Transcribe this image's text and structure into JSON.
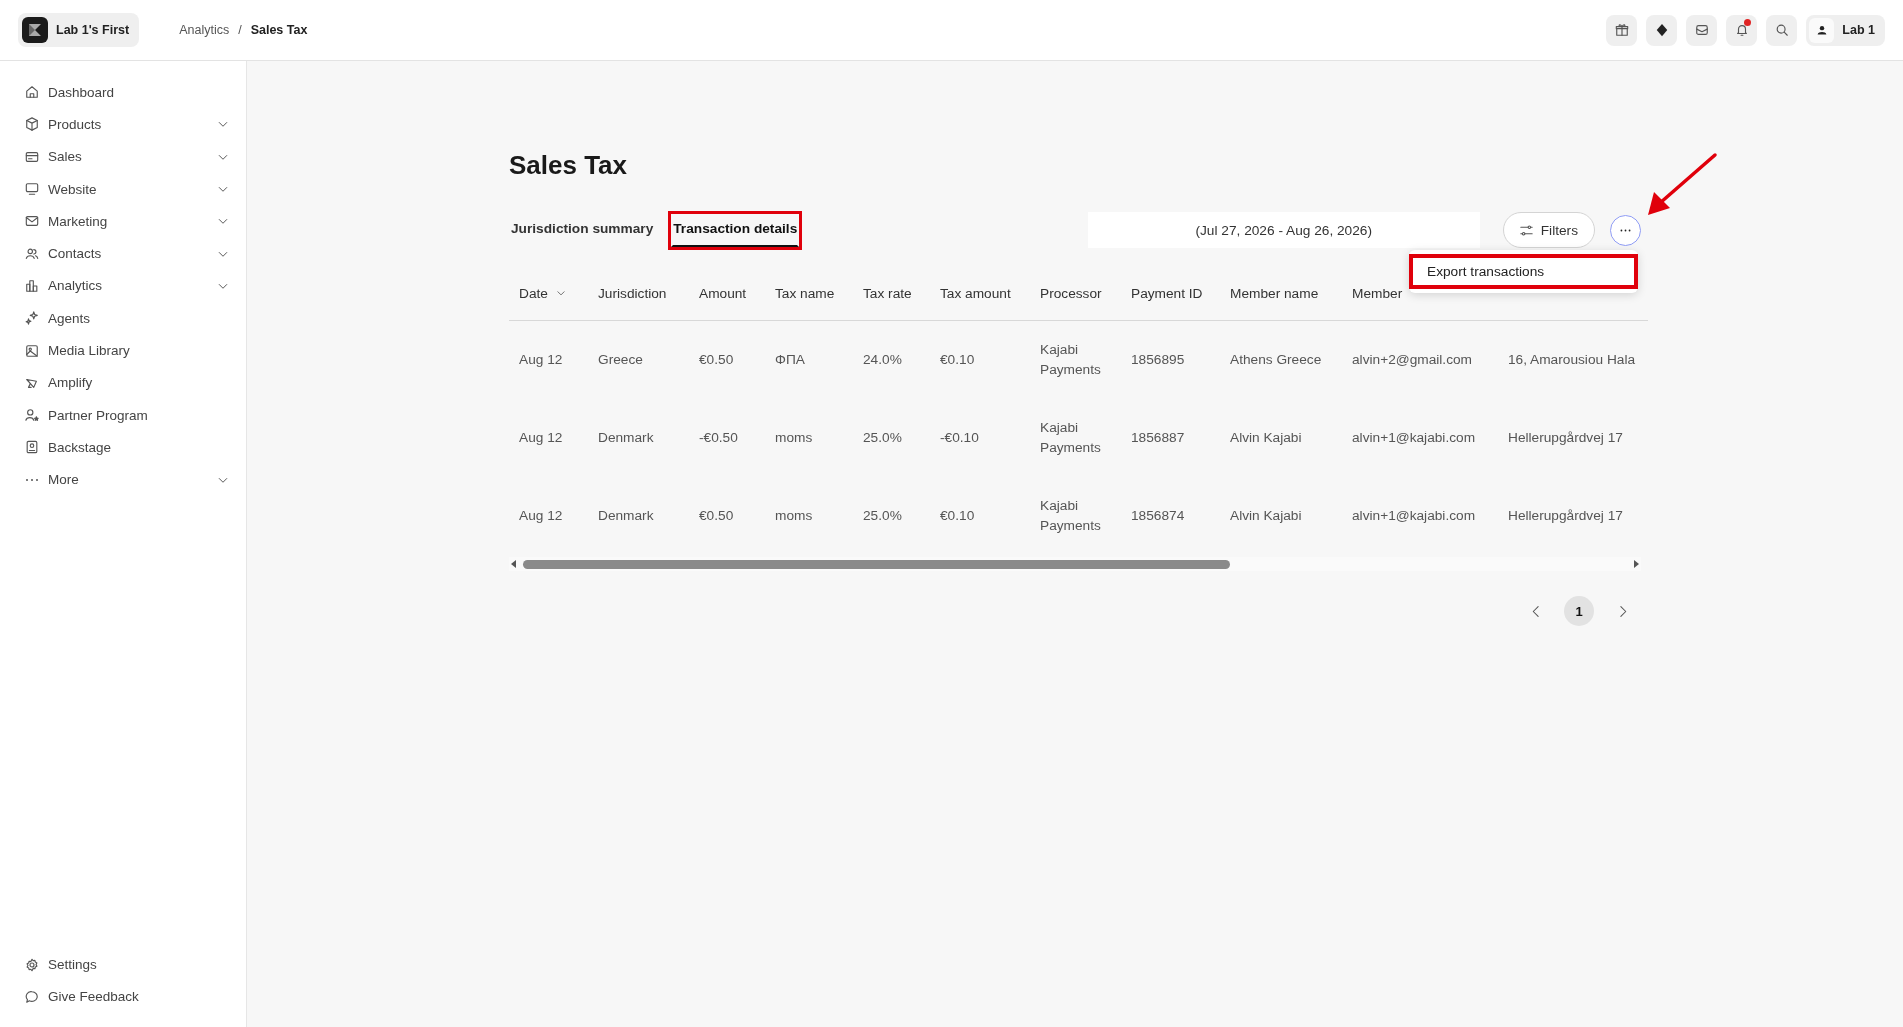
{
  "topbar": {
    "workspace": "Lab 1's First",
    "breadcrumb": [
      "Analytics",
      "Sales Tax"
    ],
    "breadcrumb_separator": "/",
    "notifications_unread": true,
    "user": "Lab 1"
  },
  "sidebar": {
    "items": [
      {
        "label": "Dashboard",
        "collapsible": false
      },
      {
        "label": "Products",
        "collapsible": true
      },
      {
        "label": "Sales",
        "collapsible": true
      },
      {
        "label": "Website",
        "collapsible": true
      },
      {
        "label": "Marketing",
        "collapsible": true
      },
      {
        "label": "Contacts",
        "collapsible": true
      },
      {
        "label": "Analytics",
        "collapsible": true
      },
      {
        "label": "Agents",
        "collapsible": false
      },
      {
        "label": "Media Library",
        "collapsible": false
      },
      {
        "label": "Amplify",
        "collapsible": false
      },
      {
        "label": "Partner Program",
        "collapsible": false
      },
      {
        "label": "Backstage",
        "collapsible": false
      },
      {
        "label": "More",
        "collapsible": true
      }
    ],
    "footer": [
      {
        "label": "Settings"
      },
      {
        "label": "Give Feedback"
      }
    ]
  },
  "page": {
    "title": "Sales Tax",
    "tabs": [
      {
        "label": "Jurisdiction summary",
        "selected": false,
        "highlighted": false
      },
      {
        "label": "Transaction details",
        "selected": true,
        "highlighted": true
      }
    ],
    "date_range": "(Jul 27, 2026 - Aug 26, 2026)",
    "filters_button": "Filters",
    "more_menu": {
      "open": true,
      "items": [
        {
          "label": "Export transactions",
          "highlighted": true
        }
      ]
    },
    "callout_arrow": true,
    "table": {
      "columns": [
        {
          "label": "Date",
          "sorted": true
        },
        {
          "label": "Jurisdiction",
          "sorted": false
        },
        {
          "label": "Amount",
          "sorted": false
        },
        {
          "label": "Tax name",
          "sorted": false
        },
        {
          "label": "Tax rate",
          "sorted": false
        },
        {
          "label": "Tax amount",
          "sorted": false
        },
        {
          "label": "Processor",
          "sorted": false
        },
        {
          "label": "Payment ID",
          "sorted": false
        },
        {
          "label": "Member name",
          "sorted": false
        },
        {
          "label": "Member",
          "sorted": false
        }
      ],
      "rows": [
        [
          "Aug 12",
          "Greece",
          "€0.50",
          "ΦΠΑ",
          "24.0%",
          "€0.10",
          "Kajabi Payments",
          "1856895",
          "Athens Greece",
          "alvin+2@gmail.com",
          "16, Amarousiou Hala"
        ],
        [
          "Aug 12",
          "Denmark",
          "-€0.50",
          "moms",
          "25.0%",
          "-€0.10",
          "Kajabi Payments",
          "1856887",
          "Alvin Kajabi",
          "alvin+1@kajabi.com",
          "Hellerupgårdvej 17"
        ],
        [
          "Aug 12",
          "Denmark",
          "€0.50",
          "moms",
          "25.0%",
          "€0.10",
          "Kajabi Payments",
          "1856874",
          "Alvin Kajabi",
          "alvin+1@kajabi.com",
          "Hellerupgårdvej 17"
        ]
      ]
    },
    "pagination": {
      "pages": [
        {
          "label": "1",
          "selected": true
        }
      ]
    }
  }
}
